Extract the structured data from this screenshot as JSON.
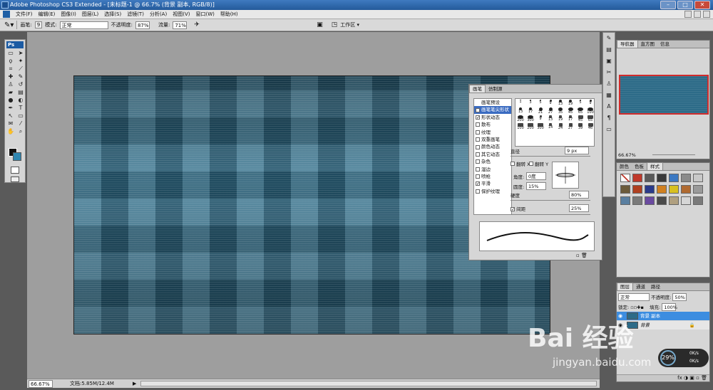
{
  "app": {
    "title": "Adobe Photoshop CS3 Extended - [未标题-1 @ 66.7% (背景 副本, RGB/8)]",
    "ps_label": "Ps"
  },
  "menu": [
    "文件(F)",
    "编辑(E)",
    "图像(I)",
    "图层(L)",
    "选择(S)",
    "滤镜(T)",
    "分析(A)",
    "视图(V)",
    "窗口(W)",
    "帮助(H)"
  ],
  "options": {
    "brush_label": "画笔:",
    "brush_size": "9",
    "mode_label": "模式:",
    "mode_value": "正常",
    "opacity_label": "不透明度:",
    "opacity_value": "87%",
    "flow_label": "流量:",
    "flow_value": "71%",
    "workspace_label": "工作区 ▾"
  },
  "status": {
    "zoom": "66.67%",
    "doc": "文档:5.85M/12.4M"
  },
  "navigator": {
    "tabs": [
      "导航器",
      "直方图",
      "信息"
    ],
    "zoom": "66.67%"
  },
  "swatches_panel": {
    "tabs": [
      "颜色",
      "色板",
      "样式"
    ],
    "colors": [
      "#f2f2f2",
      "#c0392b",
      "#5a5a5a",
      "#3a3a3a",
      "#3b78c2",
      "#8a8a8a",
      "#c9c9c9",
      "#6b5a3a",
      "#b04020",
      "#2a3a8a",
      "#d08020",
      "#d8c020",
      "#b06a30",
      "#9a9a9a",
      "#5a7fa0",
      "#7a7a7a",
      "#6a4aa0",
      "#4a4a4a",
      "#b0a080",
      "#d6d6d6",
      "#7a7a7a"
    ]
  },
  "layers": {
    "tabs": [
      "图层",
      "通道",
      "路径"
    ],
    "blend": "正常",
    "opacity_label": "不透明度:",
    "opacity_value": "50%",
    "lock_label": "锁定:",
    "fill_label": "填充:",
    "fill_value": "100%",
    "items": [
      {
        "name": "背景 副本",
        "selected": true
      },
      {
        "name": "背景",
        "selected": false
      }
    ]
  },
  "brushes": {
    "tabs": [
      "画笔",
      "仿制源"
    ],
    "list": [
      {
        "label": "画笔预设",
        "check": false,
        "sel": false
      },
      {
        "label": "画笔笔尖形状",
        "check": false,
        "sel": true
      },
      {
        "label": "形状动态",
        "check": true,
        "sel": false
      },
      {
        "label": "散布",
        "check": false,
        "sel": false
      },
      {
        "label": "纹理",
        "check": false,
        "sel": false
      },
      {
        "label": "双重画笔",
        "check": false,
        "sel": false
      },
      {
        "label": "颜色动态",
        "check": false,
        "sel": false
      },
      {
        "label": "其它动态",
        "check": false,
        "sel": false
      },
      {
        "label": "杂色",
        "check": false,
        "sel": false
      },
      {
        "label": "湿边",
        "check": false,
        "sel": false
      },
      {
        "label": "喷枪",
        "check": false,
        "sel": false
      },
      {
        "label": "平滑",
        "check": true,
        "sel": false
      },
      {
        "label": "保护纹理",
        "check": false,
        "sel": false
      }
    ],
    "tips": [
      "1",
      "3",
      "5",
      "9",
      "13",
      "19",
      "5",
      "9",
      "13",
      "17",
      "21",
      "27",
      "35",
      "45",
      "65",
      "100",
      "200",
      "300",
      "9",
      "13",
      "19",
      "17",
      "45",
      "65",
      "100",
      "200",
      "300",
      "14",
      "24",
      "27",
      "39",
      "46"
    ],
    "diameter_label": "直径",
    "diameter_value": "9 px",
    "flipx": "翻转 X",
    "flipy": "翻转 Y",
    "angle_label": "角度:",
    "angle_value": "0度",
    "round_label": "圆度:",
    "round_value": "15%",
    "hardness_label": "硬度",
    "hardness_value": "80%",
    "spacing_label": "间距",
    "spacing_value": "25%"
  },
  "watermark": {
    "main": "Bai 经验",
    "sub": "jingyan.baidu.com"
  },
  "clock": {
    "percent": "29%",
    "up": "0K/s",
    "down": "0K/s"
  }
}
